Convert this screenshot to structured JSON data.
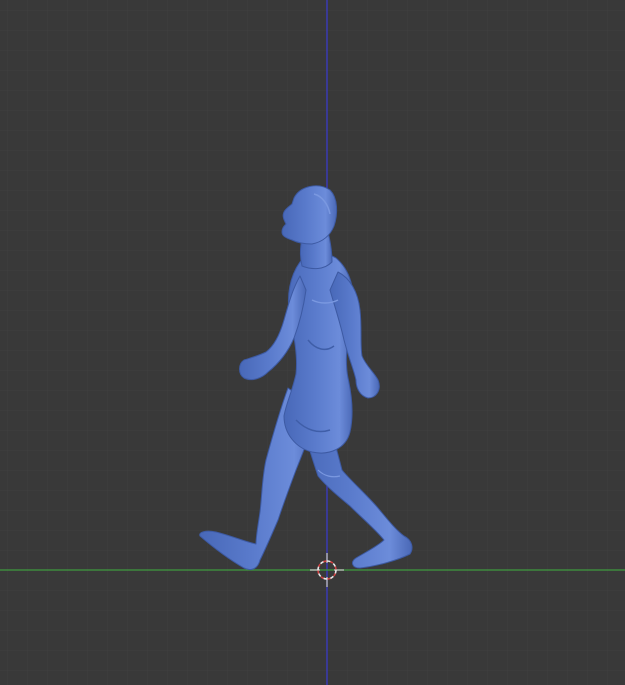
{
  "viewport": {
    "view": "side-orthographic",
    "grid": true,
    "colors": {
      "background": "#393939",
      "grid_minor": "#404040",
      "grid_major": "#444444",
      "x_axis": "#3f9a3f",
      "z_axis": "#3a3ad0",
      "mesh": "#5878c8",
      "mesh_shadow": "#3f5ea8",
      "mesh_highlight": "#7a98e0",
      "cursor_red": "#d04040",
      "cursor_white": "#e8e8e8"
    },
    "scene": {
      "object": "human-walking-mesh",
      "cursor_icon": "3d-cursor-icon"
    }
  }
}
